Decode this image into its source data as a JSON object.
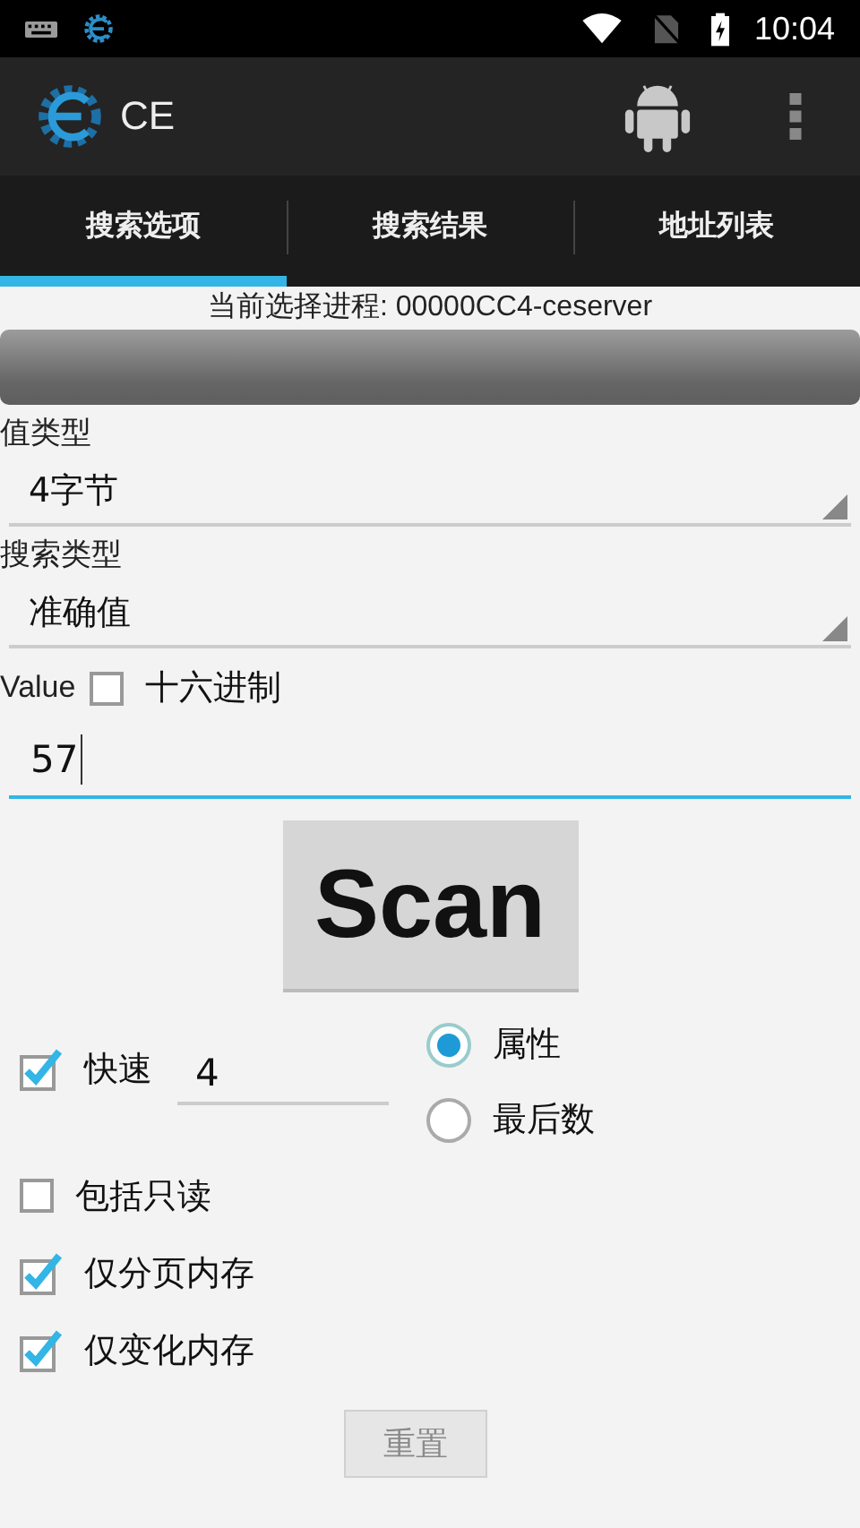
{
  "status_bar": {
    "time": "10:04"
  },
  "app_bar": {
    "title": "CE"
  },
  "tabs": [
    {
      "label": "搜索选项",
      "selected": true
    },
    {
      "label": "搜索结果",
      "selected": false
    },
    {
      "label": "地址列表",
      "selected": false
    }
  ],
  "process": {
    "text": "当前选择进程: 00000CC4-ceserver"
  },
  "value_type": {
    "label": "值类型",
    "value": "4字节"
  },
  "scan_type": {
    "label": "搜索类型",
    "value": "准确值"
  },
  "value": {
    "label": "Value",
    "hex": {
      "label": "十六进制",
      "checked": false
    },
    "input": "57"
  },
  "scan_button": "Scan",
  "fast": {
    "label": "快速",
    "checked": true,
    "value": "4"
  },
  "alignment": [
    {
      "label": "属性",
      "selected": true
    },
    {
      "label": "最后数",
      "selected": false
    }
  ],
  "options": [
    {
      "label": "包括只读",
      "checked": false
    },
    {
      "label": "仅分页内存",
      "checked": true
    },
    {
      "label": "仅变化内存",
      "checked": true
    }
  ],
  "reset_button": {
    "label": "重置",
    "disabled": true
  }
}
